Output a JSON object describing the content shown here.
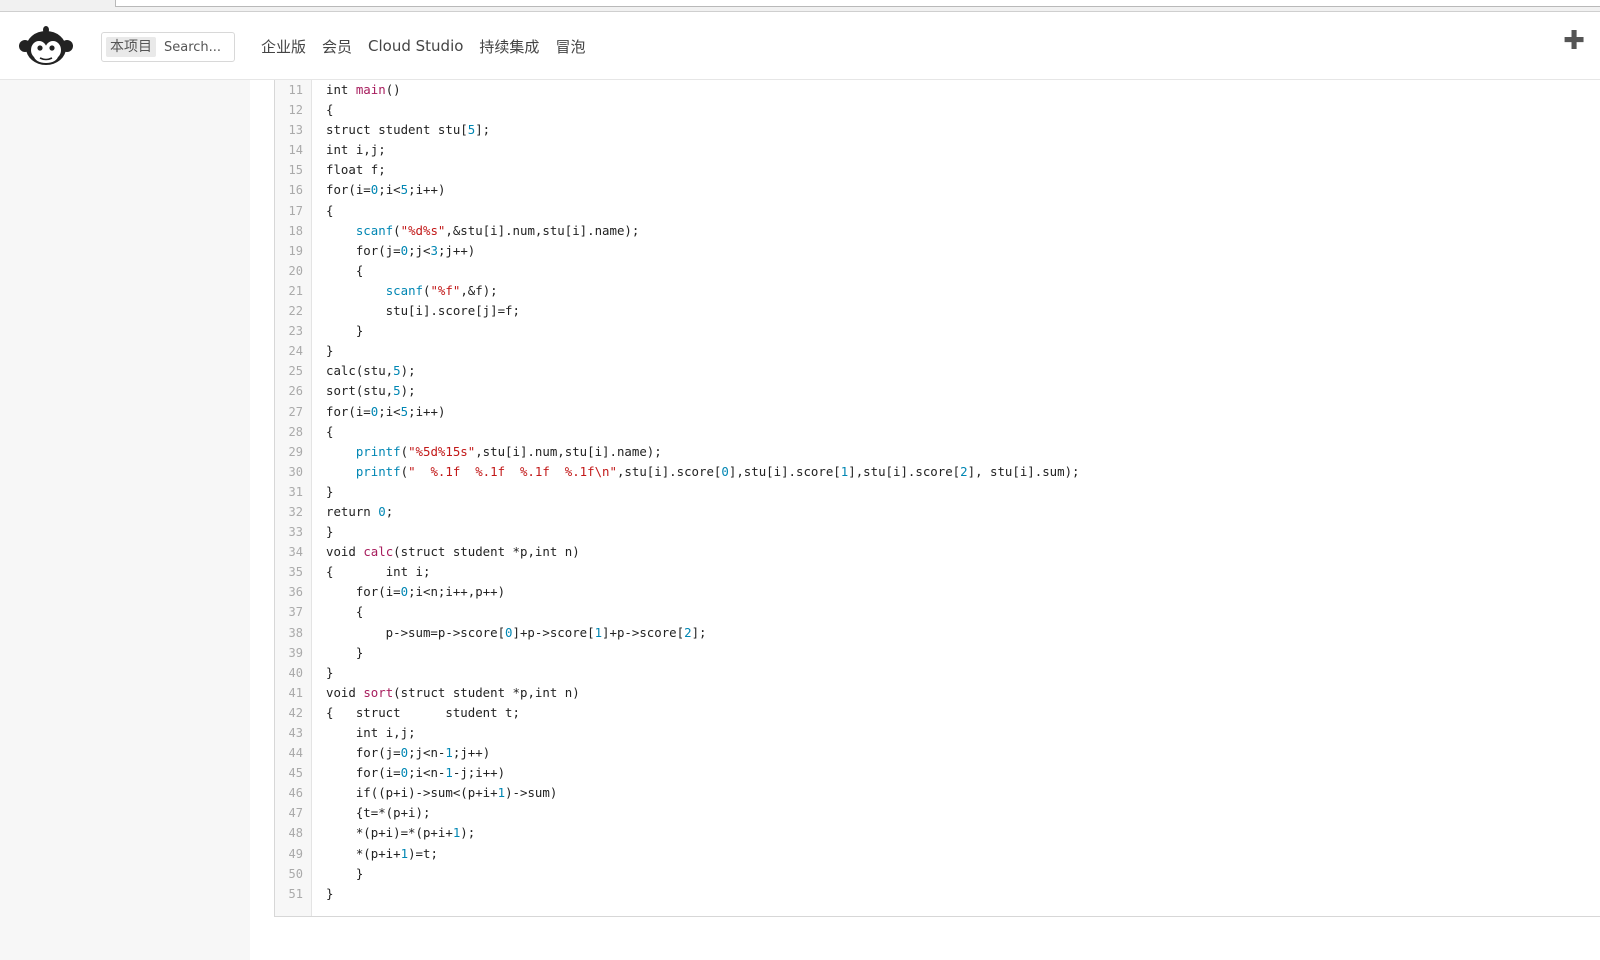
{
  "header": {
    "search": {
      "scope_label": "本项目",
      "placeholder": "Search..."
    },
    "nav": [
      "企业版",
      "会员",
      "Cloud Studio",
      "持续集成",
      "冒泡"
    ]
  },
  "code": {
    "lines": [
      {
        "n": "11",
        "t": [
          [
            "int ",
            "k"
          ],
          [
            "main",
            "f"
          ],
          [
            "()",
            ""
          ]
        ]
      },
      {
        "n": "12",
        "t": [
          [
            "{",
            ""
          ]
        ]
      },
      {
        "n": "13",
        "t": [
          [
            "struct student stu[",
            ""
          ],
          [
            "5",
            "n"
          ],
          [
            "];",
            ""
          ]
        ]
      },
      {
        "n": "14",
        "t": [
          [
            "int ",
            "k"
          ],
          [
            "i,j;",
            ""
          ]
        ]
      },
      {
        "n": "15",
        "t": [
          [
            "float ",
            "k"
          ],
          [
            "f;",
            ""
          ]
        ]
      },
      {
        "n": "16",
        "t": [
          [
            "for",
            "k"
          ],
          [
            "(i=",
            ""
          ],
          [
            "0",
            "n"
          ],
          [
            ";i<",
            ""
          ],
          [
            "5",
            "n"
          ],
          [
            ";i++)",
            ""
          ]
        ]
      },
      {
        "n": "17",
        "t": [
          [
            "{",
            ""
          ]
        ]
      },
      {
        "n": "18",
        "t": [
          [
            "    ",
            ""
          ],
          [
            "scanf",
            "b"
          ],
          [
            "(",
            ""
          ],
          [
            "\"%d%s\"",
            "s"
          ],
          [
            ",&stu[i].num,stu[i].name);",
            ""
          ]
        ]
      },
      {
        "n": "19",
        "t": [
          [
            "    ",
            ""
          ],
          [
            "for",
            "k"
          ],
          [
            "(j=",
            ""
          ],
          [
            "0",
            "n"
          ],
          [
            ";j<",
            ""
          ],
          [
            "3",
            "n"
          ],
          [
            ";j++)",
            ""
          ]
        ]
      },
      {
        "n": "20",
        "t": [
          [
            "    {",
            ""
          ]
        ]
      },
      {
        "n": "21",
        "t": [
          [
            "        ",
            ""
          ],
          [
            "scanf",
            "b"
          ],
          [
            "(",
            ""
          ],
          [
            "\"%f\"",
            "s"
          ],
          [
            ",&f);",
            ""
          ]
        ]
      },
      {
        "n": "22",
        "t": [
          [
            "        stu[i].score[j]=f;",
            ""
          ]
        ]
      },
      {
        "n": "23",
        "t": [
          [
            "    }",
            ""
          ]
        ]
      },
      {
        "n": "24",
        "t": [
          [
            "}",
            ""
          ]
        ]
      },
      {
        "n": "25",
        "t": [
          [
            "calc(stu,",
            ""
          ],
          [
            "5",
            "n"
          ],
          [
            ");",
            ""
          ]
        ]
      },
      {
        "n": "26",
        "t": [
          [
            "sort(stu,",
            ""
          ],
          [
            "5",
            "n"
          ],
          [
            ");",
            ""
          ]
        ]
      },
      {
        "n": "27",
        "t": [
          [
            "for",
            "k"
          ],
          [
            "(i=",
            ""
          ],
          [
            "0",
            "n"
          ],
          [
            ";i<",
            ""
          ],
          [
            "5",
            "n"
          ],
          [
            ";i++)",
            ""
          ]
        ]
      },
      {
        "n": "28",
        "t": [
          [
            "{",
            ""
          ]
        ]
      },
      {
        "n": "29",
        "t": [
          [
            "    ",
            ""
          ],
          [
            "printf",
            "b"
          ],
          [
            "(",
            ""
          ],
          [
            "\"%5d%15s\"",
            "s"
          ],
          [
            ",stu[i].num,stu[i].name);",
            ""
          ]
        ]
      },
      {
        "n": "30",
        "t": [
          [
            "    ",
            ""
          ],
          [
            "printf",
            "b"
          ],
          [
            "(",
            ""
          ],
          [
            "\"  %.1f  %.1f  %.1f  %.1f\\n\"",
            "s"
          ],
          [
            ",stu[i].score[",
            ""
          ],
          [
            "0",
            "n"
          ],
          [
            "],stu[i].score[",
            ""
          ],
          [
            "1",
            "n"
          ],
          [
            "],stu[i].score[",
            ""
          ],
          [
            "2",
            "n"
          ],
          [
            "], stu[i].sum);",
            ""
          ]
        ]
      },
      {
        "n": "31",
        "t": [
          [
            "}",
            ""
          ]
        ]
      },
      {
        "n": "32",
        "t": [
          [
            "return ",
            "k"
          ],
          [
            "0",
            "n"
          ],
          [
            ";",
            ""
          ]
        ]
      },
      {
        "n": "33",
        "t": [
          [
            "}",
            ""
          ]
        ]
      },
      {
        "n": "34",
        "t": [
          [
            "void ",
            "k"
          ],
          [
            "calc",
            "f"
          ],
          [
            "(",
            ""
          ],
          [
            "struct ",
            "k"
          ],
          [
            "student *p,",
            ""
          ],
          [
            "int ",
            "k"
          ],
          [
            "n)",
            ""
          ]
        ]
      },
      {
        "n": "35",
        "t": [
          [
            "{       ",
            ""
          ],
          [
            "int ",
            "k"
          ],
          [
            "i;",
            ""
          ]
        ]
      },
      {
        "n": "36",
        "t": [
          [
            "    ",
            ""
          ],
          [
            "for",
            "k"
          ],
          [
            "(i=",
            ""
          ],
          [
            "0",
            "n"
          ],
          [
            ";i<n;i++,p++)",
            ""
          ]
        ]
      },
      {
        "n": "37",
        "t": [
          [
            "    {",
            ""
          ]
        ]
      },
      {
        "n": "38",
        "t": [
          [
            "        p->sum=p->score[",
            ""
          ],
          [
            "0",
            "n"
          ],
          [
            "]+p->score[",
            ""
          ],
          [
            "1",
            "n"
          ],
          [
            "]+p->score[",
            ""
          ],
          [
            "2",
            "n"
          ],
          [
            "];",
            ""
          ]
        ]
      },
      {
        "n": "39",
        "t": [
          [
            "    }",
            ""
          ]
        ]
      },
      {
        "n": "40",
        "t": [
          [
            "}",
            ""
          ]
        ]
      },
      {
        "n": "41",
        "t": [
          [
            "void ",
            "k"
          ],
          [
            "sort",
            "f"
          ],
          [
            "(",
            ""
          ],
          [
            "struct ",
            "k"
          ],
          [
            "student *p,",
            ""
          ],
          [
            "int ",
            "k"
          ],
          [
            "n)",
            ""
          ]
        ]
      },
      {
        "n": "42",
        "t": [
          [
            "{   ",
            ""
          ],
          [
            "struct",
            "k"
          ],
          [
            "      student t;",
            ""
          ]
        ]
      },
      {
        "n": "43",
        "t": [
          [
            "    ",
            ""
          ],
          [
            "int ",
            "k"
          ],
          [
            "i,j;",
            ""
          ]
        ]
      },
      {
        "n": "44",
        "t": [
          [
            "    ",
            ""
          ],
          [
            "for",
            "k"
          ],
          [
            "(j=",
            ""
          ],
          [
            "0",
            "n"
          ],
          [
            ";j<n-",
            ""
          ],
          [
            "1",
            "n"
          ],
          [
            ";j++)",
            ""
          ]
        ]
      },
      {
        "n": "45",
        "t": [
          [
            "    ",
            ""
          ],
          [
            "for",
            "k"
          ],
          [
            "(i=",
            ""
          ],
          [
            "0",
            "n"
          ],
          [
            ";i<n-",
            ""
          ],
          [
            "1",
            "n"
          ],
          [
            "-j;i++)",
            ""
          ]
        ]
      },
      {
        "n": "46",
        "t": [
          [
            "    ",
            ""
          ],
          [
            "if",
            "k"
          ],
          [
            "((p+i)->sum<(p+i+",
            ""
          ],
          [
            "1",
            "n"
          ],
          [
            ")->sum)",
            ""
          ]
        ]
      },
      {
        "n": "47",
        "t": [
          [
            "    {t=*(p+i);",
            ""
          ]
        ]
      },
      {
        "n": "48",
        "t": [
          [
            "    *(p+i)=*(p+i+",
            ""
          ],
          [
            "1",
            "n"
          ],
          [
            ");",
            ""
          ]
        ]
      },
      {
        "n": "49",
        "t": [
          [
            "    *(p+i+",
            ""
          ],
          [
            "1",
            "n"
          ],
          [
            ")=t;",
            ""
          ]
        ]
      },
      {
        "n": "50",
        "t": [
          [
            "    }",
            ""
          ]
        ]
      },
      {
        "n": "51",
        "t": [
          [
            "}",
            ""
          ]
        ]
      }
    ]
  }
}
